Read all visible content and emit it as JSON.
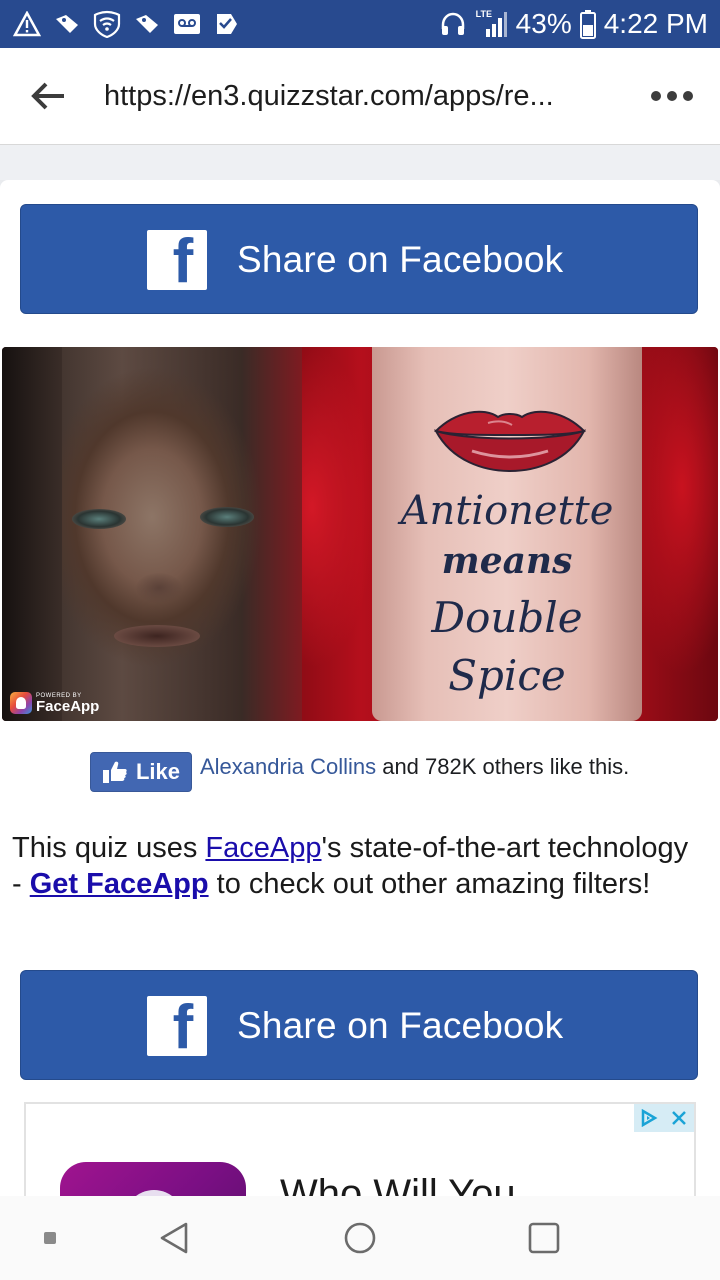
{
  "status_bar": {
    "network": "LTE",
    "battery": "43%",
    "time": "4:22 PM"
  },
  "browser": {
    "url": "https://en3.quizzstar.com/apps/re..."
  },
  "share_buttons": {
    "top_label": "Share on Facebook",
    "bottom_label": "Share on Facebook",
    "logo_glyph": "f"
  },
  "quiz_image": {
    "powered_by": "POWERED BY",
    "faceapp_brand": "FaceApp",
    "tattoo_lines": [
      "Antionette",
      "means",
      "Double",
      "Spice"
    ]
  },
  "like": {
    "button_label": "Like",
    "friend_name": "Alexandria Collins",
    "rest_text": " and 782K others like this."
  },
  "description": {
    "part1": "This quiz uses ",
    "link1": "FaceApp",
    "part2": "'s state-of-the-art technology - ",
    "link2": "Get FaceApp",
    "part3": " to check out other amazing filters!"
  },
  "ad": {
    "headline": "Who Will You"
  },
  "colors": {
    "facebook_blue": "#2d5aa8",
    "status_bar": "#284a8f",
    "link": "#1a0dab"
  }
}
